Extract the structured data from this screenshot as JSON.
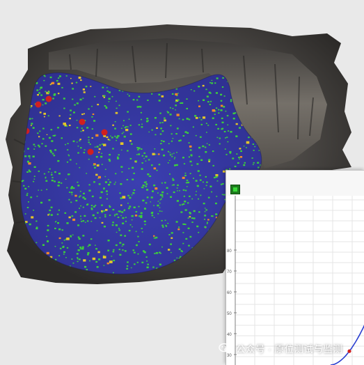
{
  "panel": {
    "y_ticks": [
      "80",
      "70",
      "60",
      "50",
      "40",
      "30"
    ]
  },
  "watermark": {
    "text": "公众号 · 原位测试与监测"
  },
  "colors": {
    "background": "#e9e9e9",
    "rock": "#4a4744",
    "map_low": "#3a3aa0",
    "map_mid": "#3ccf3c",
    "map_high": "#e3c52a",
    "map_peak": "#d02020",
    "curve": "#2a3fd0",
    "curve_marker": "#d02020",
    "app_icon": "#1d7a1d"
  },
  "icons": {
    "app": "green-square-icon",
    "watermark": "wechat-icon"
  }
}
